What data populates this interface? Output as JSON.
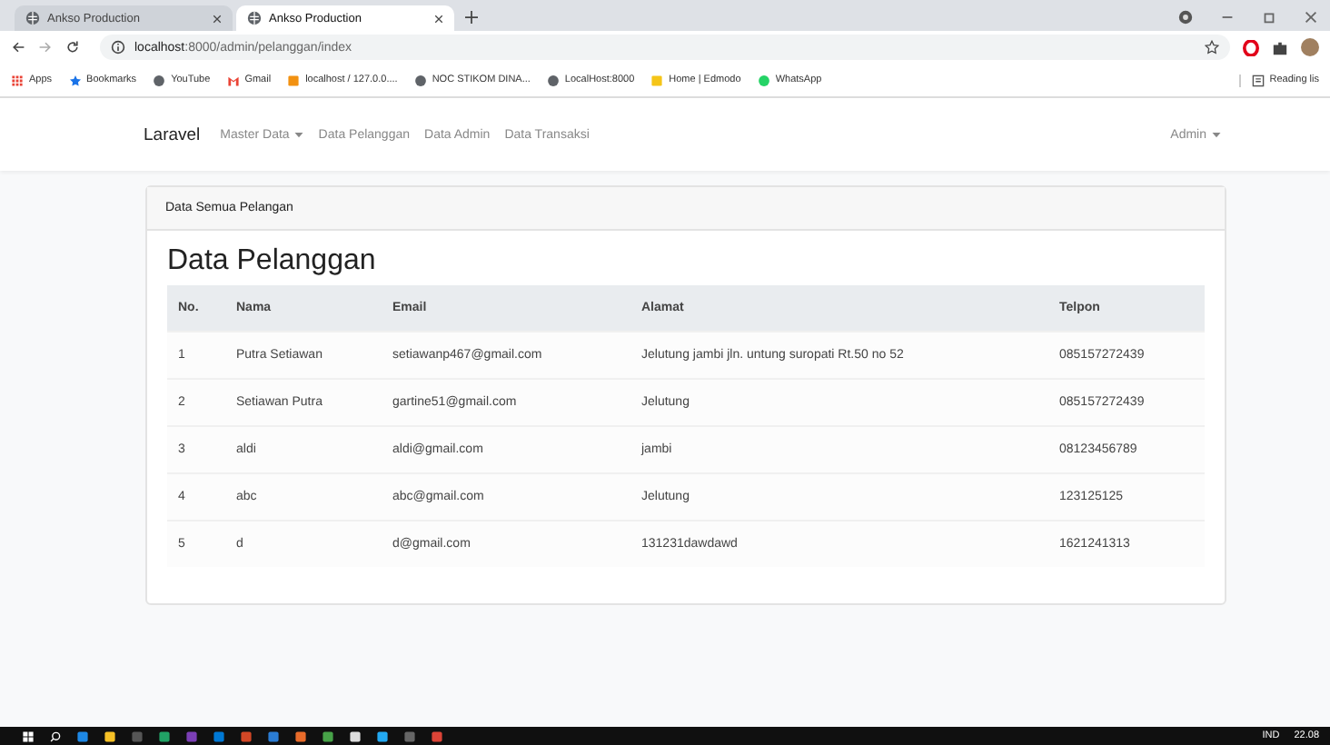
{
  "browser": {
    "tabs": [
      {
        "title": "Ankso Production",
        "selected": false
      },
      {
        "title": "Ankso Production",
        "selected": true
      }
    ],
    "url_host": "localhost",
    "url_path": ":8000/admin/pelanggan/index",
    "bookmarks": [
      {
        "label": "Apps",
        "kind": "apps"
      },
      {
        "label": "Bookmarks",
        "kind": "star"
      },
      {
        "label": "YouTube",
        "kind": "globe"
      },
      {
        "label": "Gmail",
        "kind": "gmail"
      },
      {
        "label": "localhost / 127.0.0....",
        "kind": "pma"
      },
      {
        "label": "NOC STIKOM DINA...",
        "kind": "globe"
      },
      {
        "label": "LocalHost:8000",
        "kind": "globe"
      },
      {
        "label": "Home | Edmodo",
        "kind": "edmodo"
      },
      {
        "label": "WhatsApp",
        "kind": "whatsapp"
      }
    ],
    "reading_list": "Reading lis"
  },
  "navbar": {
    "brand": "Laravel",
    "items": [
      {
        "label": "Master Data",
        "dropdown": true
      },
      {
        "label": "Data Pelanggan",
        "dropdown": false
      },
      {
        "label": "Data Admin",
        "dropdown": false
      },
      {
        "label": "Data Transaksi",
        "dropdown": false
      }
    ],
    "user": "Admin"
  },
  "card": {
    "header": "Data Semua Pelangan",
    "title": "Data Pelanggan",
    "table": {
      "columns": [
        "No.",
        "Nama",
        "Email",
        "Alamat",
        "Telpon"
      ],
      "rows": [
        [
          "1",
          "Putra Setiawan",
          "setiawanp467@gmail.com",
          "Jelutung jambi jln. untung suropati Rt.50 no 52",
          "085157272439"
        ],
        [
          "2",
          "Setiawan Putra",
          "gartine51@gmail.com",
          "Jelutung",
          "085157272439"
        ],
        [
          "3",
          "aldi",
          "aldi@gmail.com",
          "jambi",
          "08123456789"
        ],
        [
          "4",
          "abc",
          "abc@gmail.com",
          "Jelutung",
          "123125125"
        ],
        [
          "5",
          "d",
          "d@gmail.com",
          "131231dawdawd",
          "1621241313"
        ]
      ]
    }
  },
  "taskbar": {
    "language": "IND",
    "time": "22.08"
  }
}
